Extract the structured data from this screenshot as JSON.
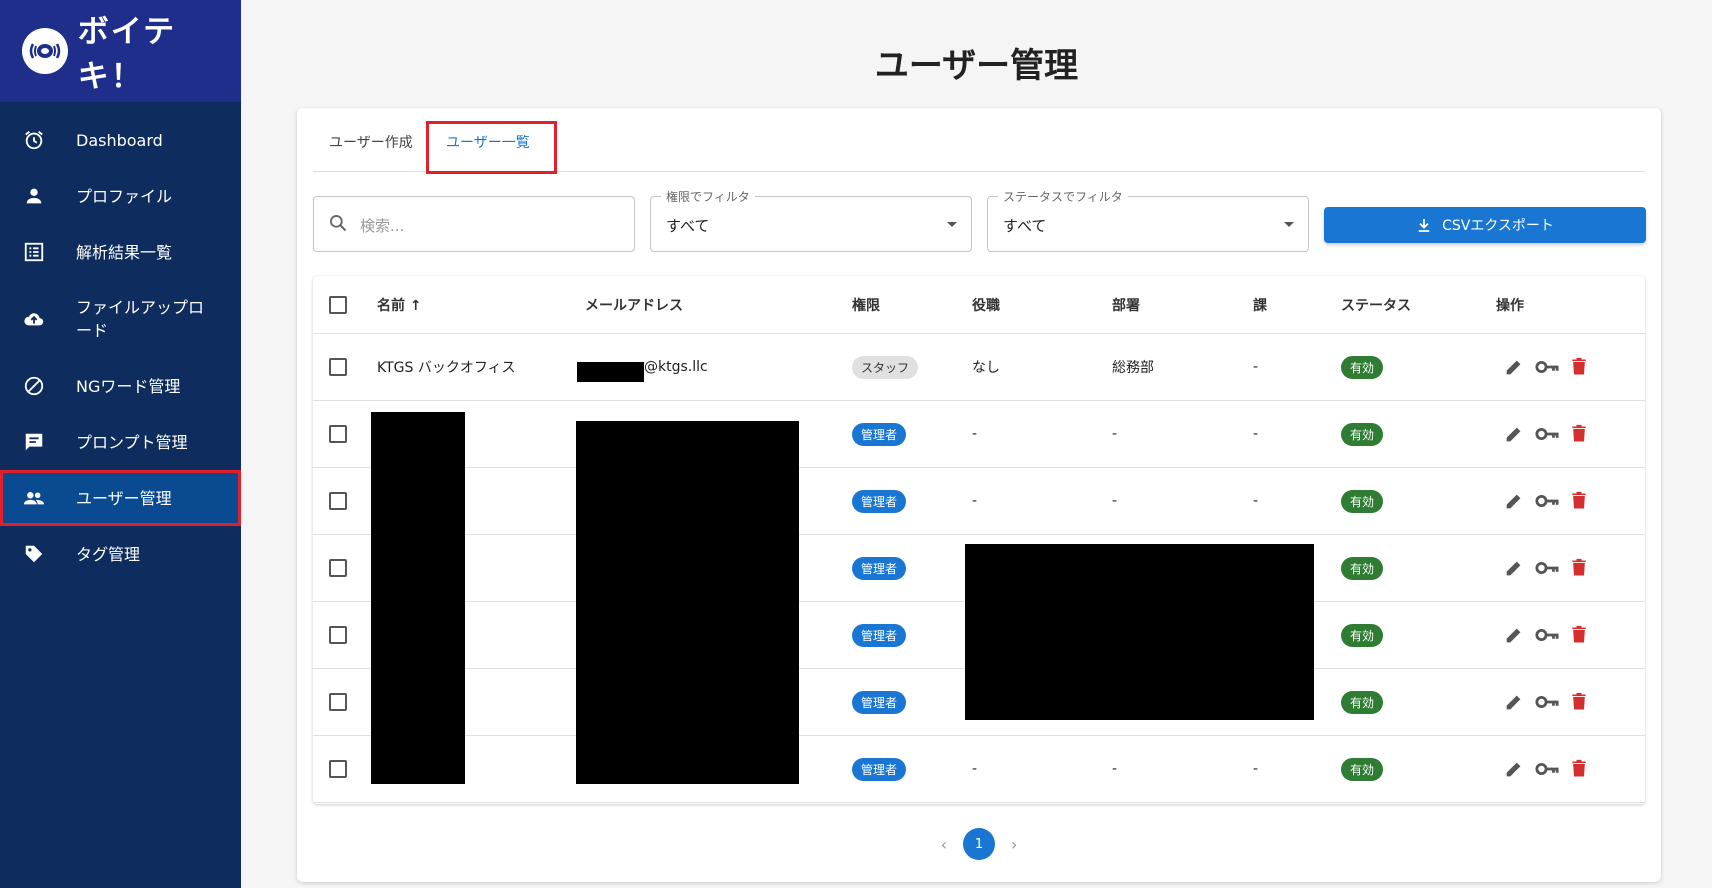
{
  "app": {
    "name": "ボイテキ！"
  },
  "sidebar": {
    "items": [
      {
        "label": "Dashboard",
        "icon": "alarm-clock-icon"
      },
      {
        "label": "プロファイル",
        "icon": "person-icon"
      },
      {
        "label": "解析結果一覧",
        "icon": "list-icon"
      },
      {
        "label": "ファイルアップロード",
        "icon": "cloud-upload-icon"
      },
      {
        "label": "NGワード管理",
        "icon": "block-icon"
      },
      {
        "label": "プロンプト管理",
        "icon": "chat-icon"
      },
      {
        "label": "ユーザー管理",
        "icon": "people-icon"
      },
      {
        "label": "タグ管理",
        "icon": "tag-icon"
      }
    ]
  },
  "page": {
    "title": "ユーザー管理"
  },
  "tabs": {
    "create": "ユーザー作成",
    "list": "ユーザー一覧"
  },
  "filters": {
    "search_placeholder": "検索...",
    "role_label": "権限でフィルタ",
    "role_value": "すべて",
    "status_label": "ステータスでフィルタ",
    "status_value": "すべて",
    "export_label": "CSVエクスポート"
  },
  "table": {
    "headers": {
      "name": "名前 ↑",
      "email": "メールアドレス",
      "role": "権限",
      "position": "役職",
      "department": "部署",
      "section": "課",
      "status": "ステータス",
      "actions": "操作"
    },
    "rows": [
      {
        "name": "KTGS バックオフィス",
        "email": "@ktgs.llc",
        "role": "スタッフ",
        "position": "なし",
        "department": "総務部",
        "section": "-",
        "status": "有効"
      },
      {
        "name": "",
        "email": "",
        "role": "管理者",
        "position": "-",
        "department": "-",
        "section": "-",
        "status": "有効"
      },
      {
        "name": "",
        "email": "",
        "role": "管理者",
        "position": "-",
        "department": "-",
        "section": "-",
        "status": "有効"
      },
      {
        "name": "",
        "email": "",
        "role": "管理者",
        "position": "",
        "department": "",
        "section": "",
        "status": "有効"
      },
      {
        "name": "",
        "email": "",
        "role": "管理者",
        "position": "",
        "department": "",
        "section": "",
        "status": "有効"
      },
      {
        "name": "",
        "email": "",
        "role": "管理者",
        "position": "",
        "department": "",
        "section": "",
        "status": "有効"
      },
      {
        "name": "",
        "email": "",
        "role": "管理者",
        "position": "-",
        "department": "-",
        "section": "-",
        "status": "有効"
      }
    ]
  },
  "pagination": {
    "current": "1",
    "prev": "‹",
    "next": "›"
  },
  "colors": {
    "sidebar": "#0f2c5e",
    "logo_bg": "#1e2e8a",
    "primary": "#1976d2",
    "success": "#2e7d32",
    "danger": "#d32f2f",
    "highlight": "#e0202a"
  }
}
